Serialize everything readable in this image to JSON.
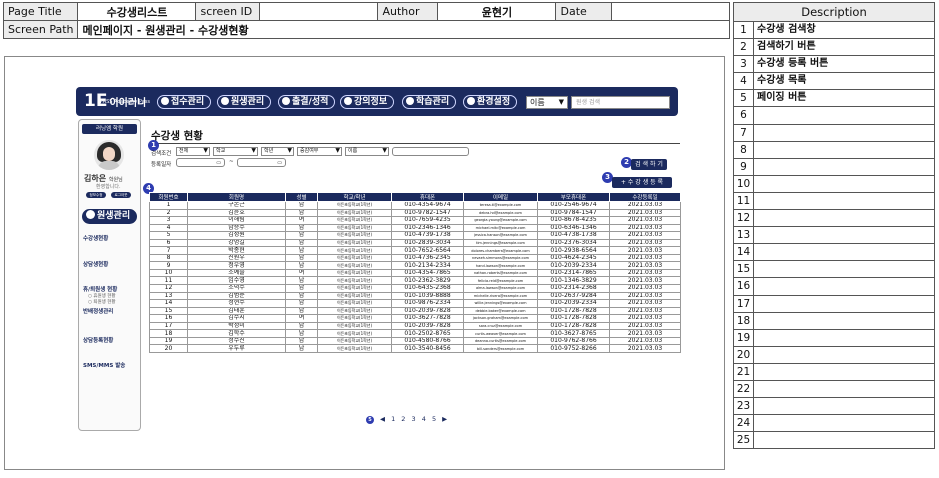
{
  "header": {
    "page_title_label": "Page Title",
    "page_title": "수강생리스트",
    "screen_id_label": "screen ID",
    "screen_id": "",
    "author_label": "Author",
    "author": "윤현기",
    "date_label": "Date",
    "date": "",
    "screen_path_label": "Screen Path",
    "screen_path": "메인페이지 - 원생관리 - 수강생현황"
  },
  "description": {
    "title": "Description",
    "items": [
      "수강생 검색창",
      "검색하기 버튼",
      "수강생 등록 버튼",
      "수강생 목록",
      "페이징 버튼",
      "",
      "",
      "",
      "",
      "",
      "",
      "",
      "",
      "",
      "",
      "",
      "",
      "",
      "",
      "",
      "",
      "",
      "",
      "",
      ""
    ]
  },
  "app": {
    "logo_big": "1E",
    "logo_name": "이이러니",
    "logo_sub": "PASS Academy Pass",
    "menu": [
      "접수관리",
      "원생관리",
      "출결/성적",
      "강의정보",
      "학습관리",
      "환경설정"
    ],
    "search_select": "이름",
    "search_placeholder": "원생 검색"
  },
  "sidebar": {
    "header": "러닝엠 학원",
    "user_name": "김하은",
    "user_suffix": "학원님",
    "welcome": "환영합니다.",
    "btn1": "정보수정",
    "btn2": "로그아웃",
    "section": "원생관리",
    "items": [
      "수강생현황",
      "상담생현황",
      "휴/퇴원생 현황",
      "휴원생 현황",
      "퇴원생 현황",
      "반배정생관리",
      "상담등록현황",
      "SMS/MMS 발송"
    ]
  },
  "main": {
    "title": "수강생 현황",
    "filter_label1": "검색조건",
    "filter_label2": "등록일자",
    "selects": [
      "전체",
      "학교",
      "학년",
      "증감여부",
      "이름"
    ],
    "date_sep": "~",
    "search_button": "검 색 하 기",
    "register_button": "+ 수 강 생 등 록",
    "callouts": [
      "1",
      "2",
      "3",
      "4",
      "5"
    ]
  },
  "table": {
    "headers": [
      "회원번호",
      "회원명",
      "성별",
      "학교/학년",
      "휴대폰",
      "이메일",
      "부모휴대폰",
      "수강등록일"
    ],
    "rows": [
      [
        "1",
        "구본근",
        "남",
        "이든초등학교(1학년)",
        "010-4354-9674",
        "teresa.ti@example.com",
        "010-2546-9674",
        "2021.03.03"
      ],
      [
        "2",
        "김윤호",
        "남",
        "이든초등학교(1학년)",
        "010-9782-1547",
        "debra.hd@example.com",
        "010-9784-1547",
        "2021.03.03"
      ],
      [
        "3",
        "이해림",
        "여",
        "이든초등학교(1학년)",
        "010-7659-4235",
        "georgia.young@example.com",
        "010-8678-4235",
        "2021.03.03"
      ],
      [
        "4",
        "남승수",
        "남",
        "이든초등학교(1학년)",
        "010-2346-1346",
        "michael.mitc@example.com",
        "010-6346-1346",
        "2021.03.03"
      ],
      [
        "5",
        "김성원",
        "남",
        "이든초등학교(1학년)",
        "010-4739-1738",
        "jessica.hanson@example.com",
        "010-4738-1738",
        "2021.03.03"
      ],
      [
        "6",
        "강명길",
        "남",
        "이든초등학교(1학년)",
        "010-2839-3034",
        "tim.jennings@example.com",
        "010-2376-3034",
        "2021.03.03"
      ],
      [
        "7",
        "박종현",
        "남",
        "이든초등학교(1학년)",
        "010-7652-6564",
        "dolores.chambers@example.com",
        "010-2938-6564",
        "2021.03.03"
      ],
      [
        "8",
        "진원우",
        "남",
        "이든초등학교(1학년)",
        "010-4736-2345",
        "nevaeh.simmons@example.com",
        "010-4624-2345",
        "2021.03.03"
      ],
      [
        "9",
        "정우영",
        "남",
        "이든초등학교(1학년)",
        "010-2134-2334",
        "hand.lawson@example.com",
        "010-2039-2334",
        "2021.03.03"
      ],
      [
        "10",
        "조예솔",
        "여",
        "이든초등학교(1학년)",
        "010-4354-7865",
        "nathan.roberts@example.com",
        "010-2314-7865",
        "2021.03.03"
      ],
      [
        "11",
        "임수영",
        "남",
        "이든초등학교(1학년)",
        "010-2362-3829",
        "felicia.reid@example.com",
        "010-1346-3829",
        "2021.03.03"
      ],
      [
        "12",
        "조덕수",
        "남",
        "이든초등학교(1학년)",
        "010-6435-2368",
        "alma.lawson@example.com",
        "010-2314-2368",
        "2021.03.03"
      ],
      [
        "13",
        "김범준",
        "남",
        "이든초등학교(1학년)",
        "010-1039-8888",
        "michelle.rivera@example.com",
        "010-2637-9284",
        "2021.03.03"
      ],
      [
        "14",
        "정현수",
        "남",
        "이든초등학교(1학년)",
        "010-9876-2334",
        "willie.jennings@example.com",
        "010-2039-2334",
        "2021.03.03"
      ],
      [
        "15",
        "김태훈",
        "남",
        "이든초등학교(1학년)",
        "010-2039-7828",
        "debbie.baker@example.com",
        "010-1728-7828",
        "2021.03.03"
      ],
      [
        "16",
        "김수지",
        "여",
        "이든초등학교(1학년)",
        "010-3627-7828",
        "jackson.graham@example.com",
        "010-1728-7828",
        "2021.03.03"
      ],
      [
        "17",
        "박정미",
        "남",
        "이든초등학교(1학년)",
        "010-2039-7828",
        "sara.cruz@example.com",
        "010-1728-7828",
        "2021.03.03"
      ],
      [
        "18",
        "김학수",
        "남",
        "이든초등학교(1학년)",
        "010-2502-8765",
        "curtis.weaver@example.com",
        "010-3627-8765",
        "2021.03.03"
      ],
      [
        "19",
        "정수진",
        "남",
        "이든초등학교(1학년)",
        "010-4580-8766",
        "deanna.curtis@example.com",
        "010-9762-8766",
        "2021.03.03"
      ],
      [
        "20",
        "우두루",
        "남",
        "이든초등학교(1학년)",
        "010-3540-8456",
        "bill.sanders@example.com",
        "010-9752-8266",
        "2021.03.03"
      ]
    ]
  },
  "pagination": {
    "prev": "◀",
    "pages": [
      "1",
      "2",
      "3",
      "4",
      "5"
    ],
    "next": "▶"
  }
}
